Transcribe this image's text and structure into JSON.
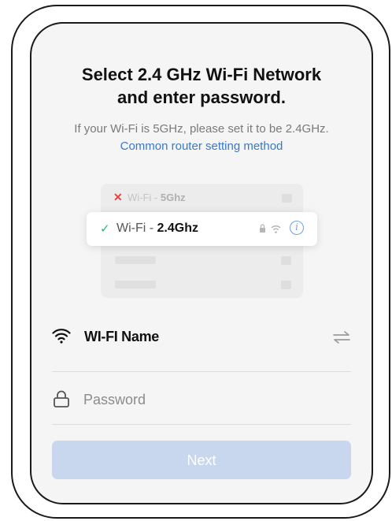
{
  "heading": {
    "line1": "Select 2.4 GHz Wi-Fi Network",
    "line2": "and enter password."
  },
  "subtitle": "If your Wi-Fi is 5GHz, please set it to be 2.4GHz.",
  "router_link": "Common router setting method",
  "illustration": {
    "bad_network": {
      "prefix": "Wi-Fi - ",
      "band": "5Ghz"
    },
    "good_network": {
      "prefix": "Wi-Fi - ",
      "band": "2.4Ghz"
    }
  },
  "wifi_name": {
    "label": "WI-FI Name",
    "icon": "wifi-icon",
    "switch_icon": "swap-icon"
  },
  "password": {
    "placeholder": "Password",
    "icon": "lock-icon"
  },
  "next_button": {
    "label": "Next"
  },
  "colors": {
    "link": "#3a78c9",
    "button_disabled": "#c8d7ee",
    "check": "#2bb673",
    "cross": "#e04545",
    "info": "#6ba3e0"
  }
}
